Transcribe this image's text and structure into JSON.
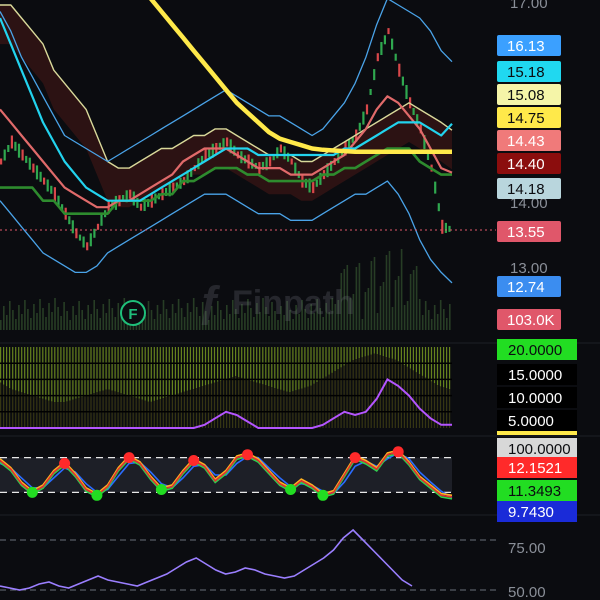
{
  "watermark": {
    "brand": "Finpath",
    "marker_letter": "F"
  },
  "colors": {
    "background": "#0b0c10",
    "bb_line": "#4aa3e8",
    "ichimoku_cloud": "#d9d99a",
    "cloud_fill_bear": "#3a1616",
    "cloud_fill_bull": "#2a2f1e",
    "ma_yellow": "#ffe94a",
    "ma_cyan": "#22d3ee",
    "ma_red": "#e06a6a",
    "kijun_green": "#2e8b2e",
    "volume_bar": "#2e4a2a",
    "adx_green": "#6f8f1f",
    "adx_purple": "#b455ff",
    "stoch_red_dot": "#ff2a2a",
    "stoch_green_dot": "#22dd22",
    "rsi_purple": "#9b7fff"
  },
  "chart_data": [
    {
      "type": "line",
      "panel": "price",
      "y_ticks": [
        "17.00",
        "14.00",
        "13.00"
      ],
      "price_badges": [
        {
          "label": "16.13",
          "bg": "#3ba0ff",
          "fg": "#ffffff"
        },
        {
          "label": "15.18",
          "bg": "#20d8f0",
          "fg": "#0b0c10"
        },
        {
          "label": "15.08",
          "bg": "#f5f5a8",
          "fg": "#0b0c10"
        },
        {
          "label": "14.75",
          "bg": "#ffe94a",
          "fg": "#0b0c10"
        },
        {
          "label": "14.43",
          "bg": "#f07a7a",
          "fg": "#ffffff"
        },
        {
          "label": "14.40",
          "bg": "#8b0d0d",
          "fg": "#ffffff"
        },
        {
          "label": "14.18",
          "bg": "#b9d6dd",
          "fg": "#0b0c10"
        },
        {
          "label": "13.55",
          "bg": "#e0576a",
          "fg": "#ffffff"
        },
        {
          "label": "12.74",
          "bg": "#3b8df0",
          "fg": "#ffffff"
        },
        {
          "label": "103.0K",
          "bg": "#e0576a",
          "fg": "#ffffff"
        }
      ],
      "last_price": 13.55,
      "ylim": [
        12.6,
        17.0
      ],
      "series": [
        {
          "key": "close",
          "values": [
            14.6,
            14.9,
            14.7,
            14.5,
            14.3,
            14.1,
            13.8,
            13.5,
            13.3,
            13.6,
            13.9,
            14.0,
            14.1,
            13.9,
            14.0,
            14.1,
            14.2,
            14.3,
            14.5,
            14.7,
            14.8,
            14.9,
            14.7,
            14.6,
            14.5,
            14.6,
            14.8,
            14.6,
            14.3,
            14.2,
            14.4,
            14.6,
            14.8,
            15.0,
            15.4,
            16.2,
            16.6,
            16.0,
            15.5,
            15.1,
            14.5,
            13.6,
            13.55
          ]
        },
        {
          "key": "ma_cyan",
          "values": [
            16.8,
            16.4,
            16.0,
            15.6,
            15.2,
            14.9,
            14.6,
            14.4,
            14.2,
            14.1,
            14.0,
            14.0,
            14.0,
            14.0,
            14.1,
            14.2,
            14.3,
            14.4,
            14.5,
            14.6,
            14.7,
            14.8,
            14.8,
            14.8,
            14.7,
            14.7,
            14.7,
            14.7,
            14.7,
            14.7,
            14.7,
            14.7,
            14.8,
            14.8,
            14.9,
            15.0,
            15.1,
            15.2,
            15.2,
            15.2,
            15.1,
            15.0,
            15.18
          ]
        },
        {
          "key": "ma_yellow",
          "values": [
            null,
            null,
            null,
            null,
            null,
            null,
            null,
            null,
            null,
            null,
            null,
            null,
            null,
            null,
            17.1,
            16.9,
            16.7,
            16.5,
            16.3,
            16.1,
            15.9,
            15.7,
            15.5,
            15.35,
            15.2,
            15.05,
            14.95,
            14.9,
            14.85,
            14.8,
            14.78,
            14.77,
            14.76,
            14.75,
            14.75,
            14.75,
            14.75,
            14.75,
            14.75,
            14.75,
            14.75,
            14.75,
            14.75
          ]
        },
        {
          "key": "ma_red",
          "values": [
            15.4,
            15.2,
            15.0,
            14.8,
            14.6,
            14.4,
            14.2,
            14.1,
            14.0,
            13.9,
            13.9,
            14.0,
            14.0,
            14.1,
            14.2,
            14.3,
            14.4,
            14.6,
            14.7,
            14.8,
            14.8,
            14.8,
            14.7,
            14.6,
            14.5,
            14.5,
            14.5,
            14.4,
            14.4,
            14.4,
            14.5,
            14.6,
            14.7,
            14.9,
            15.1,
            15.4,
            15.6,
            15.5,
            15.3,
            15.1,
            14.8,
            14.5,
            14.43
          ]
        },
        {
          "key": "bb_upper",
          "values": [
            16.9,
            16.6,
            16.2,
            15.9,
            15.6,
            15.3,
            15.0,
            14.9,
            14.8,
            14.7,
            14.6,
            14.7,
            14.8,
            14.9,
            15.0,
            15.1,
            15.2,
            15.3,
            15.4,
            15.5,
            15.6,
            15.7,
            15.6,
            15.5,
            15.4,
            15.3,
            15.3,
            15.2,
            15.1,
            15.0,
            15.1,
            15.3,
            15.5,
            15.8,
            16.2,
            16.7,
            17.1,
            17.0,
            16.9,
            16.8,
            16.6,
            16.3,
            16.13
          ]
        },
        {
          "key": "bb_lower",
          "values": [
            14.0,
            13.8,
            13.6,
            13.4,
            13.2,
            13.1,
            13.0,
            12.9,
            12.9,
            13.0,
            13.2,
            13.3,
            13.4,
            13.5,
            13.6,
            13.7,
            13.8,
            13.9,
            14.0,
            14.1,
            14.1,
            14.1,
            14.0,
            13.9,
            13.8,
            13.8,
            13.8,
            13.7,
            13.7,
            13.7,
            13.8,
            13.9,
            14.0,
            14.1,
            14.1,
            14.2,
            14.3,
            14.1,
            13.8,
            13.4,
            13.1,
            12.9,
            12.74
          ]
        },
        {
          "key": "cloud_edge",
          "values": [
            17.0,
            17.0,
            16.8,
            16.6,
            16.4,
            16.0,
            15.8,
            15.6,
            15.4,
            15.0,
            14.6,
            14.5,
            14.5,
            14.6,
            14.7,
            14.8,
            14.8,
            14.9,
            15.0,
            15.0,
            15.1,
            15.1,
            15.0,
            14.9,
            14.8,
            14.7,
            14.7,
            14.7,
            14.6,
            14.6,
            14.7,
            14.8,
            14.9,
            15.0,
            15.1,
            15.2,
            15.3,
            15.4,
            15.5,
            15.4,
            15.3,
            15.2,
            15.08
          ]
        },
        {
          "key": "kijun",
          "values": [
            14.2,
            14.2,
            14.2,
            14.2,
            14.0,
            14.0,
            13.8,
            13.8,
            13.8,
            13.8,
            13.8,
            14.0,
            14.0,
            14.0,
            14.0,
            14.1,
            14.1,
            14.3,
            14.3,
            14.4,
            14.5,
            14.5,
            14.5,
            14.4,
            14.4,
            14.3,
            14.3,
            14.3,
            14.3,
            14.3,
            14.4,
            14.4,
            14.5,
            14.5,
            14.6,
            14.7,
            14.8,
            14.8,
            14.8,
            14.6,
            14.5,
            14.4,
            14.4
          ]
        }
      ]
    },
    {
      "type": "bar",
      "panel": "adx",
      "badges": [
        {
          "label": "20.0000",
          "bg": "#22dd22",
          "fg": "#0b0c10"
        },
        {
          "label": "15.0000",
          "bg": "#000000",
          "fg": "#ffffff"
        },
        {
          "label": "10.0000",
          "bg": "#000000",
          "fg": "#ffffff"
        },
        {
          "label": "5.0000",
          "bg": "#000000",
          "fg": "#ffffff"
        }
      ],
      "ylim": [
        0,
        25
      ],
      "bars": [
        14,
        12,
        11,
        10,
        9,
        8,
        8,
        9,
        10,
        11,
        12,
        11,
        10,
        9,
        8,
        9,
        10,
        11,
        12,
        13,
        14,
        15,
        16,
        15,
        14,
        13,
        12,
        11,
        12,
        13,
        15,
        17,
        19,
        21,
        22,
        23,
        22,
        21,
        19,
        17,
        15,
        13,
        12
      ],
      "purple_line": [
        0,
        0,
        0,
        0,
        0,
        0,
        0,
        0,
        0,
        0,
        0,
        0,
        0,
        0,
        0,
        0,
        0,
        0,
        0,
        1,
        3,
        5,
        4,
        2,
        0,
        0,
        0,
        0,
        0,
        0,
        1,
        3,
        5,
        4,
        5,
        9,
        15,
        13,
        10,
        6,
        3,
        1,
        1
      ]
    },
    {
      "type": "line",
      "panel": "stochastic",
      "badges": [
        {
          "label": "100.0000",
          "bg": "#d8d8d8",
          "fg": "#0b0c10"
        },
        {
          "label": "12.1521",
          "bg": "#ff2a2a",
          "fg": "#ffffff"
        },
        {
          "label": "11.3493",
          "bg": "#22dd22",
          "fg": "#0b0c10"
        },
        {
          "label": "9.7430",
          "bg": "#1a2bd8",
          "fg": "#ffffff"
        }
      ],
      "ylim": [
        0,
        100
      ],
      "levels": [
        80,
        20
      ],
      "k": [
        75,
        60,
        35,
        20,
        30,
        55,
        70,
        50,
        25,
        15,
        30,
        60,
        80,
        70,
        45,
        25,
        30,
        55,
        75,
        65,
        40,
        55,
        80,
        85,
        75,
        55,
        35,
        25,
        40,
        30,
        15,
        20,
        50,
        80,
        72,
        60,
        85,
        90,
        70,
        45,
        30,
        15,
        12
      ],
      "d": [
        70,
        62,
        45,
        28,
        28,
        45,
        62,
        55,
        35,
        20,
        25,
        48,
        70,
        72,
        55,
        35,
        28,
        45,
        65,
        68,
        50,
        50,
        70,
        82,
        80,
        62,
        45,
        30,
        35,
        32,
        22,
        18,
        38,
        65,
        74,
        65,
        78,
        88,
        78,
        55,
        38,
        22,
        11
      ],
      "red_dots": [
        3,
        4,
        5,
        8,
        9,
        10,
        12,
        15,
        17
      ],
      "green_dots": [
        1,
        2,
        3,
        7,
        8,
        9,
        10,
        13,
        14,
        15,
        17
      ]
    },
    {
      "type": "line",
      "panel": "rsi",
      "y_ticks": [
        "75.00",
        "50.00"
      ],
      "ylim": [
        45,
        85
      ],
      "values": [
        52,
        51,
        50,
        51,
        53,
        54,
        52,
        51,
        53,
        55,
        57,
        55,
        54,
        53,
        52,
        54,
        56,
        58,
        61,
        64,
        66,
        63,
        60,
        58,
        59,
        61,
        60,
        58,
        57,
        56,
        57,
        60,
        63,
        66,
        70,
        76,
        80,
        75,
        70,
        65,
        60,
        55,
        52
      ]
    }
  ]
}
